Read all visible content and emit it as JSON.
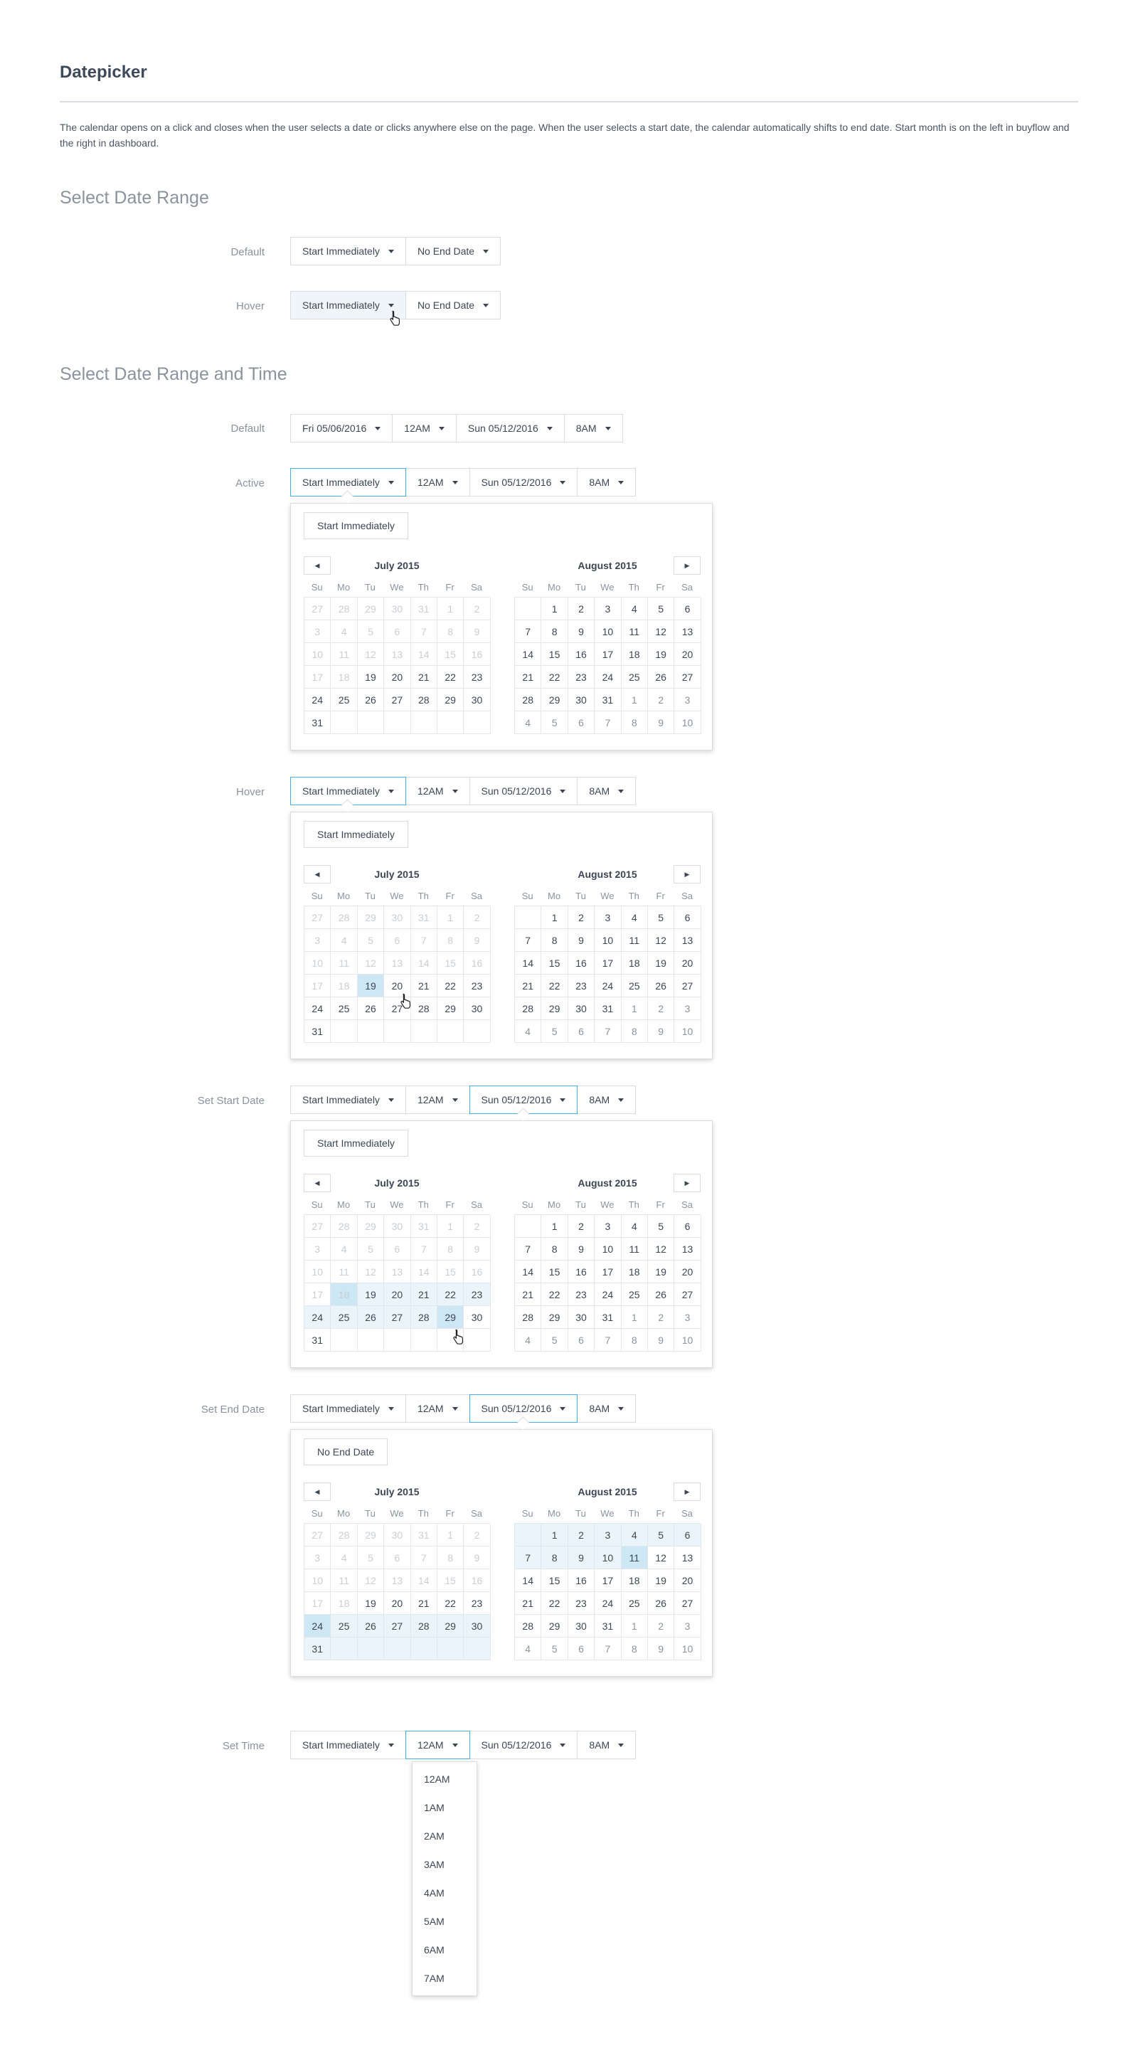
{
  "page": {
    "title": "Datepicker",
    "description": "The calendar opens on a click and closes when the user selects a date or clicks anywhere else on the page. When the user selects a start date, the calendar automatically shifts to end date. Start month is on the left in buyflow and the right in dashboard."
  },
  "section1": {
    "title": "Select Date Range",
    "rows": [
      {
        "label": "Default",
        "start": "Start Immediately",
        "end": "No End Date"
      },
      {
        "label": "Hover",
        "start": "Start Immediately",
        "end": "No End Date"
      }
    ]
  },
  "section2": {
    "title": "Select Date Range and Time",
    "default_row": {
      "label": "Default",
      "start_date": "Fri 05/06/2016",
      "start_time": "12AM",
      "end_date": "Sun 05/12/2016",
      "end_time": "8AM"
    },
    "rows": [
      {
        "label": "Active",
        "start": "Start Immediately",
        "start_time": "12AM",
        "end_date": "Sun 05/12/2016",
        "end_time": "8AM",
        "quick": "Start Immediately",
        "left_month": "July 2015",
        "right_month": "August 2015"
      },
      {
        "label": "Hover",
        "start": "Start Immediately",
        "start_time": "12AM",
        "end_date": "Sun 05/12/2016",
        "end_time": "8AM",
        "quick": "Start Immediately",
        "left_month": "July 2015",
        "right_month": "August 2015"
      },
      {
        "label": "Set Start Date",
        "start": "Start Immediately",
        "start_time": "12AM",
        "end_date": "Sun 05/12/2016",
        "end_time": "8AM",
        "quick": "Start Immediately",
        "left_month": "July 2015",
        "right_month": "August 2015"
      },
      {
        "label": "Set End Date",
        "start": "Start Immediately",
        "start_time": "12AM",
        "end_date": "Sun 05/12/2016",
        "end_time": "8AM",
        "quick": "No End Date",
        "left_month": "July 2015",
        "right_month": "August 2015"
      }
    ],
    "time_row": {
      "label": "Set Time",
      "start": "Start Immediately",
      "start_time": "12AM",
      "end_date": "Sun 05/12/2016",
      "end_time": "8AM"
    },
    "time_options": [
      "12AM",
      "1AM",
      "2AM",
      "3AM",
      "4AM",
      "5AM",
      "6AM",
      "7AM"
    ]
  },
  "calendar": {
    "weekdays": [
      "Su",
      "Mo",
      "Tu",
      "We",
      "Th",
      "Fr",
      "Sa"
    ],
    "july": [
      "27",
      "28",
      "29",
      "30",
      "31",
      "1",
      "2",
      "3",
      "4",
      "5",
      "6",
      "7",
      "8",
      "9",
      "10",
      "11",
      "12",
      "13",
      "14",
      "15",
      "16",
      "17",
      "18",
      "19",
      "20",
      "21",
      "22",
      "23",
      "24",
      "25",
      "26",
      "27",
      "28",
      "29",
      "30",
      "31",
      "",
      "",
      "",
      "",
      "",
      ""
    ],
    "august": [
      "",
      "1",
      "2",
      "3",
      "4",
      "5",
      "6",
      "7",
      "8",
      "9",
      "10",
      "11",
      "12",
      "13",
      "14",
      "15",
      "16",
      "17",
      "18",
      "19",
      "20",
      "21",
      "22",
      "23",
      "24",
      "25",
      "26",
      "27",
      "28",
      "29",
      "30",
      "31",
      "1",
      "2",
      "3",
      "4",
      "5",
      "6",
      "7",
      "8",
      "9",
      "10"
    ]
  },
  "colors": {
    "accent": "#43aee0",
    "selected": "#cde7f5",
    "range": "#eaf5fb",
    "border": "#d9dde2"
  },
  "icons": [
    "caret-down-icon",
    "chevron-left-icon",
    "chevron-right-icon",
    "hand-cursor-icon"
  ]
}
